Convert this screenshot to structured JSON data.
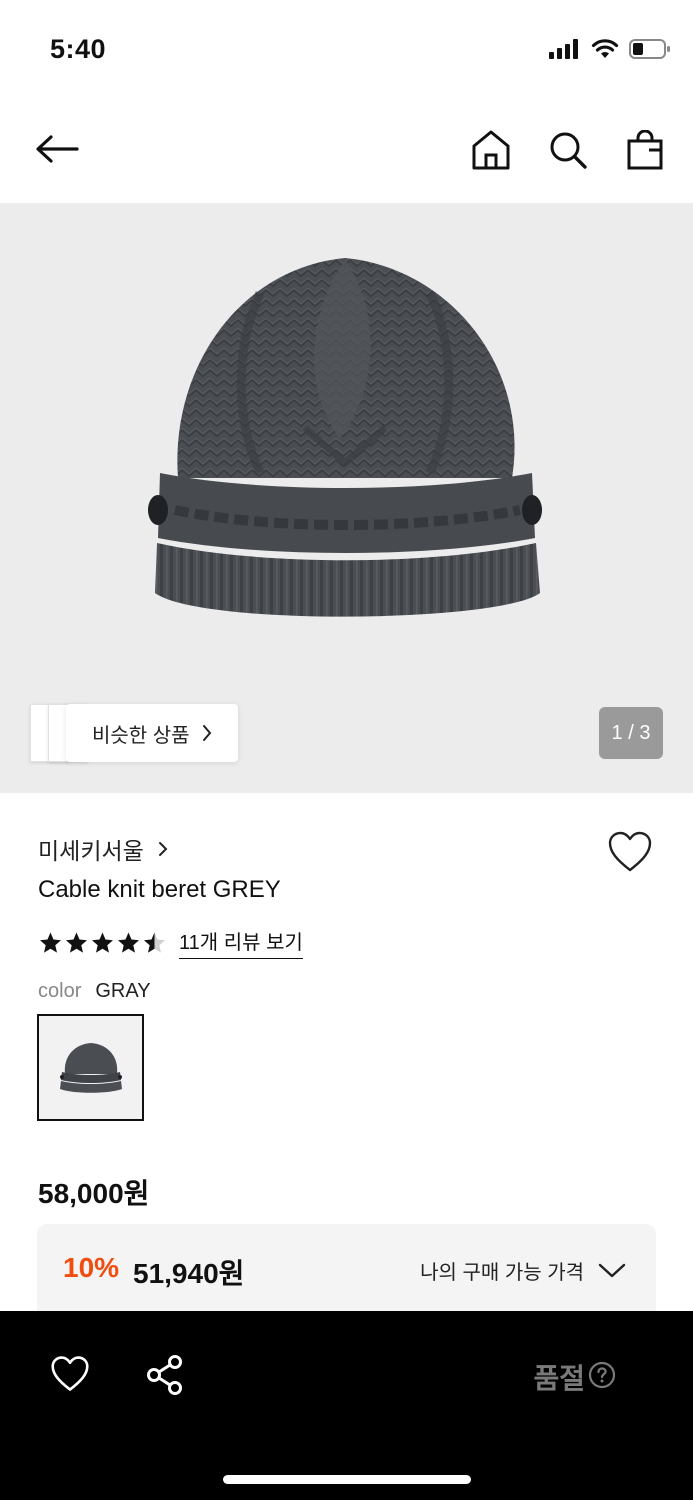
{
  "status_bar": {
    "time": "5:40"
  },
  "nav": {
    "back_icon": "arrow-left-icon",
    "home_icon": "home-icon",
    "search_icon": "search-icon",
    "cart_icon": "shopping-bag-icon"
  },
  "gallery": {
    "similar_label": "비슷한 상품",
    "page_counter": "1 / 3",
    "background": "#ececec"
  },
  "product": {
    "brand": "미세키서울",
    "name": "Cable knit beret GREY",
    "rating": 4.5,
    "review_link": "11개 리뷰 보기",
    "color_label": "color",
    "color_value": "GRAY",
    "original_price": "58,000원",
    "discount_rate": "10%",
    "sale_price": "51,940원",
    "price_dropdown_label": "나의 구매 가능 가격"
  },
  "bottom_bar": {
    "soldout_label": "품절",
    "wish_icon": "heart-icon",
    "share_icon": "share-icon",
    "help_icon": "question-circle-icon"
  },
  "colors": {
    "accent_discount": "#f04d0f",
    "bottom_bar": "#000000",
    "soldout_text": "#7a7a7a"
  }
}
